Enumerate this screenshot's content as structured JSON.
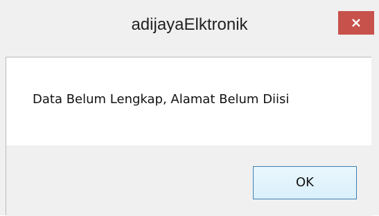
{
  "window": {
    "title": "adijayaElktronik",
    "close_icon": "close-icon",
    "close_button_color": "#c7524b"
  },
  "message": {
    "text": "Data Belum Lengkap, Alamat Belum Diisi"
  },
  "buttons": {
    "ok_label": "OK"
  }
}
